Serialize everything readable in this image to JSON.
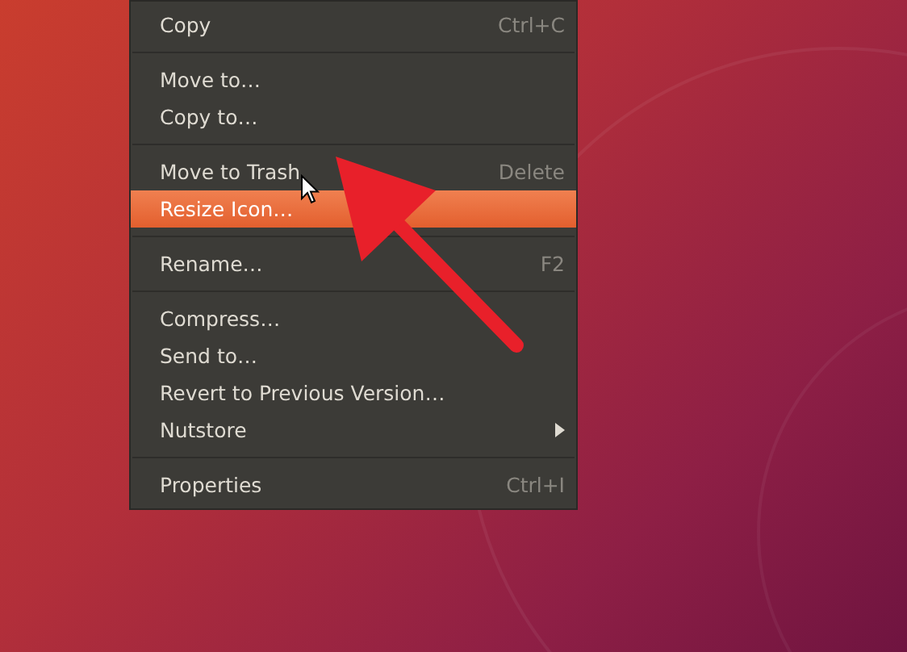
{
  "context_menu": {
    "items": [
      {
        "kind": "item",
        "label": "Copy",
        "shortcut": "Ctrl+C",
        "submenu": false,
        "selected": false
      },
      {
        "kind": "separator"
      },
      {
        "kind": "item",
        "label": "Move to…",
        "submenu": false,
        "selected": false
      },
      {
        "kind": "item",
        "label": "Copy to…",
        "submenu": false,
        "selected": false
      },
      {
        "kind": "separator"
      },
      {
        "kind": "item",
        "label": "Move to Trash",
        "shortcut": "Delete",
        "submenu": false,
        "selected": false
      },
      {
        "kind": "item",
        "label": "Resize Icon…",
        "submenu": false,
        "selected": true
      },
      {
        "kind": "separator"
      },
      {
        "kind": "item",
        "label": "Rename…",
        "shortcut": "F2",
        "submenu": false,
        "selected": false
      },
      {
        "kind": "separator"
      },
      {
        "kind": "item",
        "label": "Compress…",
        "submenu": false,
        "selected": false
      },
      {
        "kind": "item",
        "label": "Send to…",
        "submenu": false,
        "selected": false
      },
      {
        "kind": "item",
        "label": "Revert to Previous Version…",
        "submenu": false,
        "selected": false
      },
      {
        "kind": "item",
        "label": "Nutstore",
        "submenu": true,
        "selected": false
      },
      {
        "kind": "separator"
      },
      {
        "kind": "item",
        "label": "Properties",
        "shortcut": "Ctrl+I",
        "submenu": false,
        "selected": false
      }
    ]
  }
}
